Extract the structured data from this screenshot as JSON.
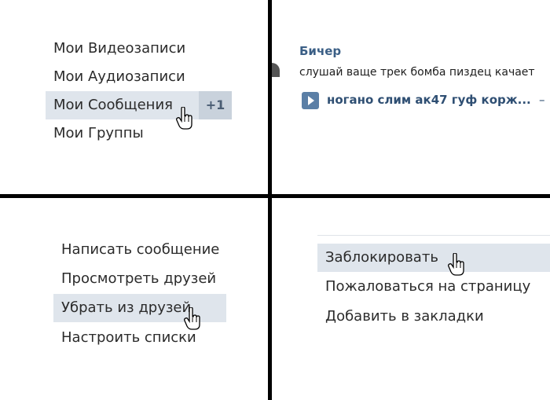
{
  "panel_profile_menu": {
    "items": [
      {
        "label": "Мои Видеозаписи"
      },
      {
        "label": "Мои Аудиозаписи"
      },
      {
        "label": "Мои Сообщения",
        "badge": "+1"
      },
      {
        "label": "Мои Группы"
      }
    ]
  },
  "panel_message": {
    "sender": "Бичер",
    "text": "слушай ваще трек бомба пиздец качает",
    "track_title": "ногано слим ак47 гуф корж...",
    "track_suffix": "–"
  },
  "panel_friend_menu": {
    "items": [
      {
        "label": "Написать сообщение"
      },
      {
        "label": "Просмотреть друзей"
      },
      {
        "label": "Убрать из друзей"
      },
      {
        "label": "Настроить списки"
      }
    ]
  },
  "panel_page_menu": {
    "items": [
      {
        "label": "Заблокировать"
      },
      {
        "label": "Пожаловаться на страницу"
      },
      {
        "label": "Добавить в закладки"
      }
    ]
  },
  "colors": {
    "highlight": "#dfe5ec",
    "badge_bg": "#c9d2dc",
    "link_blue": "#3b5f86",
    "play_button": "#5b7fa6"
  },
  "icons": [
    "hand-pointer-icon",
    "play-icon"
  ]
}
